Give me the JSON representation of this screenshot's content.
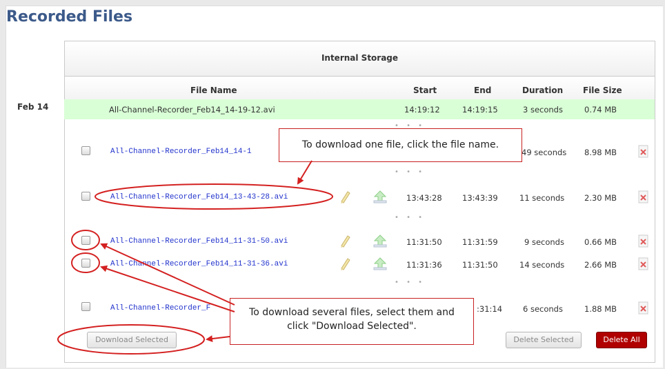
{
  "page": {
    "title": "Recorded Files"
  },
  "storage": {
    "label": "Internal Storage"
  },
  "columns": {
    "file_name": "File Name",
    "start": "Start",
    "end": "End",
    "duration": "Duration",
    "file_size": "File Size"
  },
  "date_group": "Feb 14",
  "current_recording": {
    "file": "All-Channel-Recorder_Feb14_14-19-12.avi",
    "start": "14:19:12",
    "end": "14:19:15",
    "duration": "3 seconds",
    "size": "0.74 MB"
  },
  "rows": [
    {
      "file": "All-Channel-Recorder_Feb14_14-1",
      "start": "",
      "end": "",
      "duration": "49 seconds",
      "size": "8.98 MB"
    },
    {
      "file": "All-Channel-Recorder_Feb14_13-43-28.avi",
      "start": "13:43:28",
      "end": "13:43:39",
      "duration": "11 seconds",
      "size": "2.30 MB"
    },
    {
      "file": "All-Channel-Recorder_Feb14_11-31-50.avi",
      "start": "11:31:50",
      "end": "11:31:59",
      "duration": "9 seconds",
      "size": "0.66 MB"
    },
    {
      "file": "All-Channel-Recorder_Feb14_11-31-36.avi",
      "start": "11:31:36",
      "end": "11:31:50",
      "duration": "14 seconds",
      "size": "2.66 MB"
    },
    {
      "file": "All-Channel-Recorder_F",
      "start": "",
      "end": ":31:14",
      "duration": "6 seconds",
      "size": "1.88 MB"
    }
  ],
  "dots": "• • •",
  "buttons": {
    "download_selected": "Download Selected",
    "delete_selected": "Delete Selected",
    "delete_all": "Delete All"
  },
  "callouts": {
    "one_file": "To download one file, click the file name.",
    "several_line1": "To download several files, select them and",
    "several_line2": "click \"Download Selected\"."
  },
  "colors": {
    "title": "#3c5a8a",
    "link": "#2233cc",
    "highlight": "#d9ffd6",
    "annotation": "#d42020",
    "delete_all": "#b00000"
  }
}
